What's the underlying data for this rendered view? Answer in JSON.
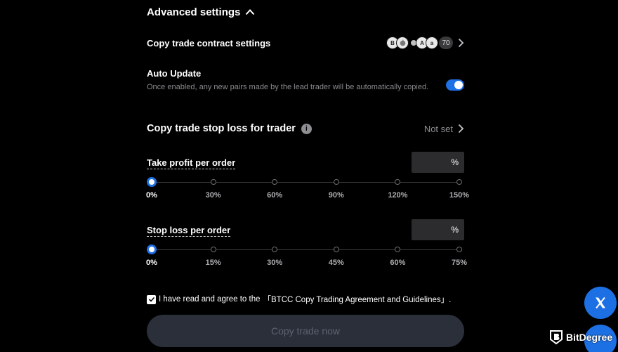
{
  "advanced": {
    "title": "Advanced settings"
  },
  "contract": {
    "label": "Copy trade contract settings",
    "coins": [
      "B",
      "",
      "A",
      "a"
    ],
    "more_count": "70"
  },
  "auto_update": {
    "title": "Auto Update",
    "description": "Once enabled, any new pairs made by the lead trader will be automatically copied.",
    "enabled": true
  },
  "stop_loss_trader": {
    "title": "Copy trade stop loss for trader",
    "value": "Not set"
  },
  "take_profit": {
    "label": "Take profit per order",
    "unit": "%",
    "ticks": [
      "0%",
      "30%",
      "60%",
      "90%",
      "120%",
      "150%"
    ],
    "selected": "0%"
  },
  "stop_loss": {
    "label": "Stop loss per order",
    "unit": "%",
    "ticks": [
      "0%",
      "15%",
      "30%",
      "45%",
      "60%",
      "75%"
    ],
    "selected": "0%"
  },
  "agreement": {
    "checked": true,
    "text": "I have read and agree to the ",
    "link": "「BTCC Copy Trading Agreement and Guidelines」."
  },
  "cta": {
    "label": "Copy trade now"
  },
  "watermark": {
    "text": "BitDegree"
  },
  "colors": {
    "accent": "#1f6fe5",
    "background": "#000000",
    "muted": "#8e8e93"
  }
}
